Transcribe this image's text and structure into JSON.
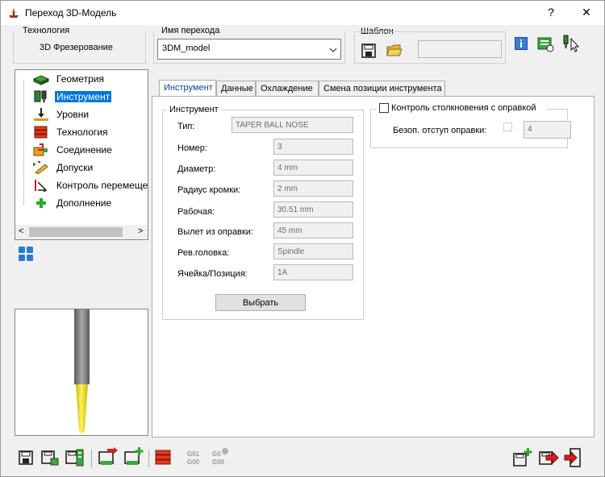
{
  "window": {
    "title": "Переход 3D-Модель",
    "help_label": "?",
    "close_label": "✕"
  },
  "technology": {
    "group_label": "Технология",
    "value": "3D Фрезерование"
  },
  "operation_name": {
    "group_label": "Имя перехода",
    "value": "3DM_model"
  },
  "template": {
    "group_label": "Шаблон",
    "value": ""
  },
  "tree": {
    "items": [
      {
        "label": "Геометрия",
        "icon": "geometry-icon"
      },
      {
        "label": "Инструмент",
        "icon": "tool-icon"
      },
      {
        "label": "Уровни",
        "icon": "levels-icon"
      },
      {
        "label": "Технология",
        "icon": "technology-icon"
      },
      {
        "label": "Соединение",
        "icon": "link-icon"
      },
      {
        "label": "Допуски",
        "icon": "tolerance-icon"
      },
      {
        "label": "Контроль перемеще",
        "icon": "motion-control-icon"
      },
      {
        "label": "Дополнение",
        "icon": "addition-icon"
      }
    ],
    "selected_index": 1,
    "scroll_left": "<",
    "scroll_right": ">"
  },
  "tabs": [
    {
      "label": "Инструмент",
      "active": true
    },
    {
      "label": "Данные",
      "active": false
    },
    {
      "label": "Охлаждение",
      "active": false
    },
    {
      "label": "Смена позиции инструмента",
      "active": false
    }
  ],
  "tool": {
    "group_label": "Инструмент",
    "fields": [
      {
        "label": "Тип:",
        "value": "TAPER BALL NOSE"
      },
      {
        "label": "Номер:",
        "value": "3"
      },
      {
        "label": "Диаметр:",
        "value": "4 mm"
      },
      {
        "label": "Радиус кромки:",
        "value": "2 mm"
      },
      {
        "label": "Рабочая:",
        "value": "30.51 mm"
      },
      {
        "label": "Вылет из оправки:",
        "value": "45 mm"
      },
      {
        "label": "Рев.головка:",
        "value": "Spindle"
      },
      {
        "label": "Ячейка/Позиция:",
        "value": "1A"
      }
    ],
    "select_button": "Выбрать"
  },
  "holder_collision": {
    "label": "Контроль столкновения с оправкой",
    "checked": false,
    "clearance_label": "Безоп. отступ оправки:",
    "clearance_checked": false,
    "clearance_value": "4"
  },
  "bottom_toolbar": {
    "left_icons": [
      "save-icon",
      "save-as-icon",
      "save-all-icon",
      "save-to-db-icon",
      "add-to-db-icon",
      "stock-layers-icon",
      "gcode-icon",
      "gcode-sim-icon"
    ],
    "right_icons": [
      "add-next-icon",
      "save-exit-icon",
      "exit-icon"
    ]
  },
  "colors": {
    "selection": "#0078d7",
    "active_tab_text": "#0645ad",
    "tool_shank": "#8c8c8c",
    "tool_tip": "#f0e020"
  }
}
